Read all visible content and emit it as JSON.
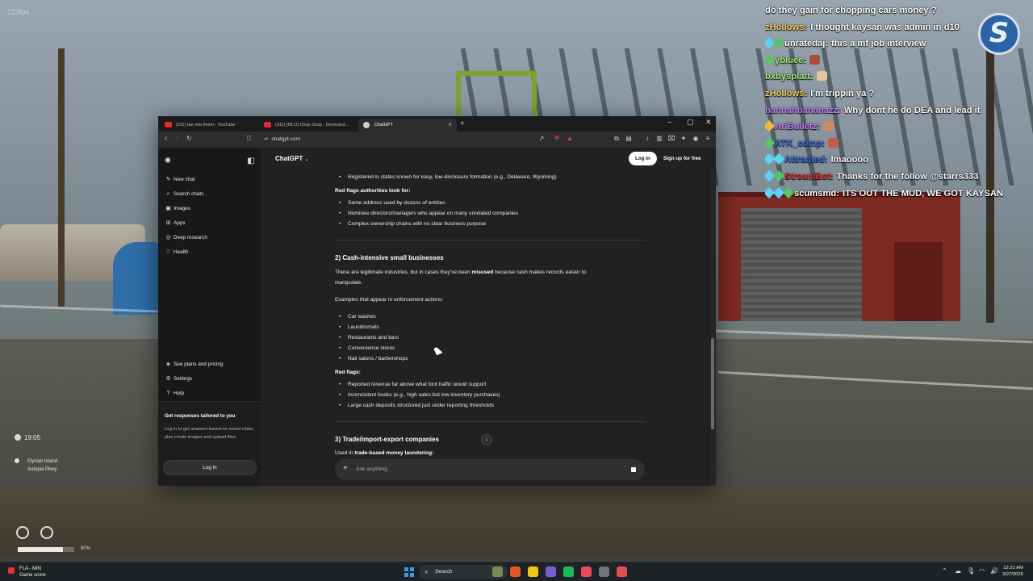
{
  "overlay": {
    "fps": "123fps",
    "chat": [
      {
        "user": "",
        "text": "do they gain for chopping cars money ?",
        "color": "#ffffff",
        "icons": []
      },
      {
        "user": "zHollows:",
        "text": "I thought kaysan was admin in d10",
        "color": "#f3d35a",
        "icons": []
      },
      {
        "user": "unratedaj:",
        "text": "this a mf job interview",
        "color": "#ffffff",
        "icons": [
          "#5bd3f2",
          "#59c36a"
        ]
      },
      {
        "user": "ybluee:",
        "text": "",
        "color": "#9ff07a",
        "icons": [
          "#59c36a"
        ],
        "emote": "#b04a38"
      },
      {
        "user": "bxbysplatt:",
        "text": "",
        "color": "#9ff07a",
        "icons": [],
        "emote": "#e3c79a"
      },
      {
        "user": "zHollows:",
        "text": "I'm trippin ya ?",
        "color": "#f3d35a",
        "icons": []
      },
      {
        "user": "hannahbananazz:",
        "text": "Why dont he do DEA and lead it",
        "color": "#c77dff",
        "icons": []
      },
      {
        "user": "AriBulletz:",
        "text": "",
        "color": "#c77dff",
        "icons": [
          "#f0b93a"
        ],
        "emote": "#d08a66"
      },
      {
        "user": "ATK_comp:",
        "text": "",
        "color": "#3a6de0",
        "icons": [
          "#59c36a"
        ],
        "emote": "#c25a4d"
      },
      {
        "user": "Attraqted:",
        "text": "lmaoooo",
        "color": "#3a6de0",
        "icons": [
          "#5bd3f2",
          "#5bd3f2"
        ]
      },
      {
        "user": "StreamBot:",
        "text": "Thanks for the follow @starrs333",
        "color": "#e0382d",
        "icons": [
          "#5bd3f2",
          "#59c36a"
        ]
      },
      {
        "user": "scumsmd:",
        "text": "ITS OUT THE MUD, WE GOT KAYSAN",
        "color": "#ffffff",
        "icons": [
          "#5bd3f2",
          "#5bd3f2",
          "#59c36a"
        ]
      }
    ],
    "logo_letter": "S",
    "hud_time": "19:05",
    "hud_location": [
      "Elysian Island",
      "Autopia Pkwy"
    ],
    "hud_bar_percent": 0.8,
    "hud_bar_label": "80%"
  },
  "browser": {
    "tabs": [
      {
        "label": "(311) bar mio fivem - YouTube",
        "favicon_color": "#e02b2b",
        "active": false
      },
      {
        "label": "(311) [MLO] Chop Shop - Desmand...",
        "favicon_color": "#e02b2b",
        "active": false
      },
      {
        "label": "ChatGPT",
        "favicon_color": "#cfcfcf",
        "active": true
      }
    ],
    "url": "chatgpt.com",
    "sidebar": {
      "items": [
        {
          "label": "New chat",
          "icon": "new-chat-icon",
          "glyph": "✎"
        },
        {
          "label": "Search chats",
          "icon": "search-icon",
          "glyph": "⌕"
        },
        {
          "label": "Images",
          "icon": "images-icon",
          "glyph": "▣"
        },
        {
          "label": "Apps",
          "icon": "apps-icon",
          "glyph": "⊞"
        },
        {
          "label": "Deep research",
          "icon": "deep-research-icon",
          "glyph": "◎"
        },
        {
          "label": "Health",
          "icon": "health-icon",
          "glyph": "♡"
        }
      ],
      "bottom_items": [
        {
          "label": "See plans and pricing",
          "icon": "plans-icon",
          "glyph": "◈"
        },
        {
          "label": "Settings",
          "icon": "settings-icon",
          "glyph": "⚙"
        },
        {
          "label": "Help",
          "icon": "help-icon",
          "glyph": "?"
        }
      ],
      "card_title": "Get responses tailored to you",
      "card_body": "Log in to get answers based on saved chats, plus create images and upload files.",
      "card_login": "Log in"
    },
    "header": {
      "model": "ChatGPT",
      "login": "Log in",
      "signup": "Sign up for free"
    },
    "content": {
      "li_top": "Registered in states known for easy, low-disclosure formation (e.g., Delaware, Wyoming)",
      "redflags_title": "Red flags authorities look for:",
      "redflags_items": [
        "Same address used by dozens of entities",
        "Nominee directors/managers who appear on many unrelated companies",
        "Complex ownership chains with no clear business purpose"
      ],
      "s2_title": "2) Cash-intensive small businesses",
      "s2_p1_a": "These are legitimate industries, but in cases they've been ",
      "s2_p1_b": "misused",
      "s2_p1_c": " because cash makes records easier to",
      "s2_p1_d": "manipulate.",
      "s2_p2": "Examples that appear in enforcement actions:",
      "s2_items": [
        "Car washes",
        "Laundromats",
        "Restaurants and bars",
        "Convenience stores",
        "Nail salons / barbershops"
      ],
      "s2_redflags_title": "Red flags:",
      "s2_redflags_items": [
        "Reported revenue far above what foot traffic would support",
        "Inconsistent books (e.g., high sales but low inventory purchases)",
        "Large cash deposits structured just under reporting thresholds"
      ],
      "s3_title": "3) Trade/import-export companies",
      "s3_p_a": "Used in ",
      "s3_p_b": "trade-based money laundering:"
    },
    "composer_placeholder": "Ask anything"
  },
  "taskbar": {
    "weather_line1": "FLA - MIN",
    "weather_line2": "Game score",
    "search_label": "Search",
    "time": "12:21 AM",
    "date": "3/27/2026",
    "apps": [
      "#7c8a54",
      "#e0572b",
      "#f0c419",
      "#7a5cd6",
      "#1db954",
      "#e84a5f",
      "#6c757d",
      "#e05050"
    ]
  }
}
